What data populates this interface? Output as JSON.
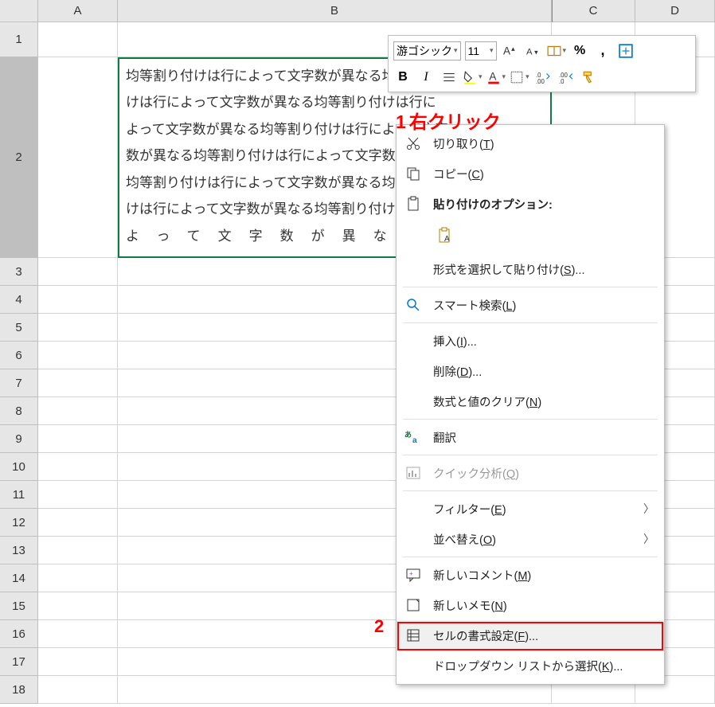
{
  "columns": [
    "A",
    "B",
    "C",
    "D"
  ],
  "rows": [
    1,
    2,
    3,
    4,
    5,
    6,
    7,
    8,
    9,
    10,
    11,
    12,
    13,
    14,
    15,
    16,
    17,
    18
  ],
  "cell_b2": {
    "line1": "均等割り付けは行によって文字数が異なる均等割り付",
    "line2": "けは行によって文字数が異なる均等割り付けは行に",
    "line3": "よって文字数が異なる均等割り付けは行によって文字",
    "line4": "数が異なる均等割り付けは行によって文字数が異なる",
    "line5": "均等割り付けは行によって文字数が異なる均等割り付",
    "line6": "けは行によって文字数が異なる均等割り付けは行に",
    "line7": "よって文字数が異なる"
  },
  "mini_toolbar": {
    "font": "游ゴシック",
    "size": "11",
    "bold": "B",
    "italic": "I"
  },
  "context_menu": {
    "cut": "切り取り(T)",
    "copy": "コピー(C)",
    "paste_label": "貼り付けのオプション:",
    "paste_special": "形式を選択して貼り付け(S)...",
    "smart_lookup": "スマート検索(L)",
    "insert": "挿入(I)...",
    "delete": "削除(D)...",
    "clear": "数式と値のクリア(N)",
    "translate": "翻訳",
    "quick_analysis": "クイック分析(Q)",
    "filter": "フィルター(E)",
    "sort": "並べ替え(O)",
    "new_comment": "新しいコメント(M)",
    "new_note": "新しいメモ(N)",
    "format_cells": "セルの書式設定(F)...",
    "dropdown_pick": "ドロップダウン リストから選択(K)..."
  },
  "annotations": {
    "a1_num": "1",
    "a1_text": "右クリック",
    "a2_num": "2"
  }
}
